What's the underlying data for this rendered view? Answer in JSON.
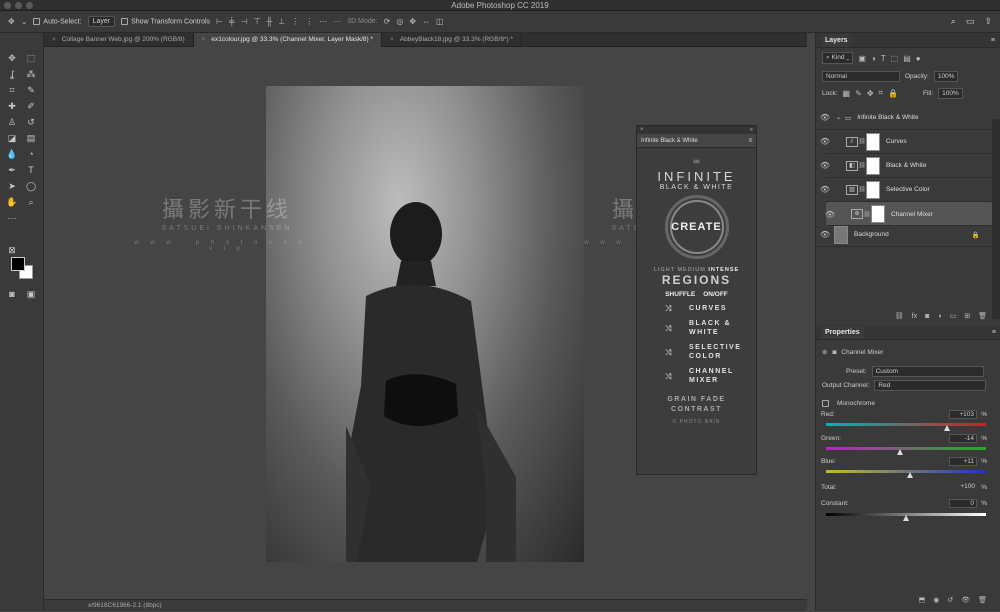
{
  "app": {
    "title": "Adobe Photoshop CC 2019"
  },
  "options_bar": {
    "auto_select_label": "Auto-Select:",
    "auto_select_value": "Layer",
    "show_transform_label": "Show Transform Controls",
    "mode_3d_label": "3D Mode:"
  },
  "tabs": [
    {
      "label": "Collage Banner Web.jpg @ 200% (RGB/8)",
      "active": false
    },
    {
      "label": "ex1colour.jpg @ 33.3% (Channel Mixer, Layer Mask/8) *",
      "active": true
    },
    {
      "label": "AbbeyBlack18.jpg @ 33.3% (RGB/8*) *",
      "active": false
    }
  ],
  "status": {
    "zoom": "33.33%",
    "doc_info": "x/9618C61966-2.1 (8bpc)"
  },
  "watermark": {
    "cn": "攝影新干线",
    "en": "SATSUEI SHINKANSEN",
    "url": "w w w . p h o t o s x s . v i p"
  },
  "plugin": {
    "tab_label": "Infinite Black & White",
    "title": "INFINITE",
    "subtitle": "BLACK & WHITE",
    "create_label": "CREATE",
    "intensity_light": "LIGHT",
    "intensity_medium": "MEDIUM",
    "intensity_intense": "INTENSE",
    "regions_label": "REGIONS",
    "shuffle_label": "SHUFFLE",
    "onoff_label": "ON/OFF",
    "rows": [
      {
        "line1": "CURVES",
        "line2": ""
      },
      {
        "line1": "BLACK &",
        "line2": "WHITE"
      },
      {
        "line1": "SELECTIVE",
        "line2": "COLOR"
      },
      {
        "line1": "CHANNEL",
        "line2": "MIXER"
      }
    ],
    "grain_label": "GRAIN FADE",
    "contrast_label": "CONTRAST",
    "brand": "© PHOTO BAIN"
  },
  "layers_panel": {
    "title": "Layers",
    "kind_label": "Kind",
    "blend_mode": "Normal",
    "opacity_label": "Opacity:",
    "opacity_value": "100%",
    "lock_label": "Lock:",
    "fill_label": "Fill:",
    "fill_value": "100%",
    "group_name": "Infinite Black & White",
    "layers": [
      {
        "name": "Curves",
        "icon": "curves-icon",
        "selected": false
      },
      {
        "name": "Black & White",
        "icon": "bw-icon",
        "selected": false
      },
      {
        "name": "Selective Color",
        "icon": "selective-color-icon",
        "selected": false
      },
      {
        "name": "Channel Mixer",
        "icon": "channel-mixer-icon",
        "selected": true
      }
    ],
    "background_name": "Background"
  },
  "properties_panel": {
    "title": "Properties",
    "adjustment_name": "Channel Mixer",
    "preset_label": "Preset:",
    "preset_value": "Custom",
    "output_channel_label": "Output Channel:",
    "output_channel_value": "Red",
    "monochrome_label": "Monochrome",
    "sliders": [
      {
        "label": "Red:",
        "value": "+103",
        "pct": "%",
        "level": 0.757,
        "colors": [
          "#00b4b4",
          "#d02020"
        ]
      },
      {
        "label": "Green:",
        "value": "-14",
        "pct": "%",
        "level": 0.465,
        "colors": [
          "#c020c0",
          "#20b020"
        ]
      },
      {
        "label": "Blue:",
        "value": "+11",
        "pct": "%",
        "level": 0.527,
        "colors": [
          "#c0c020",
          "#2030d0"
        ]
      }
    ],
    "total_label": "Total:",
    "total_value": "+100",
    "total_pct": "%",
    "constant_label": "Constant:",
    "constant_value": "0",
    "constant_pct": "%",
    "constant_level": 0.5
  }
}
